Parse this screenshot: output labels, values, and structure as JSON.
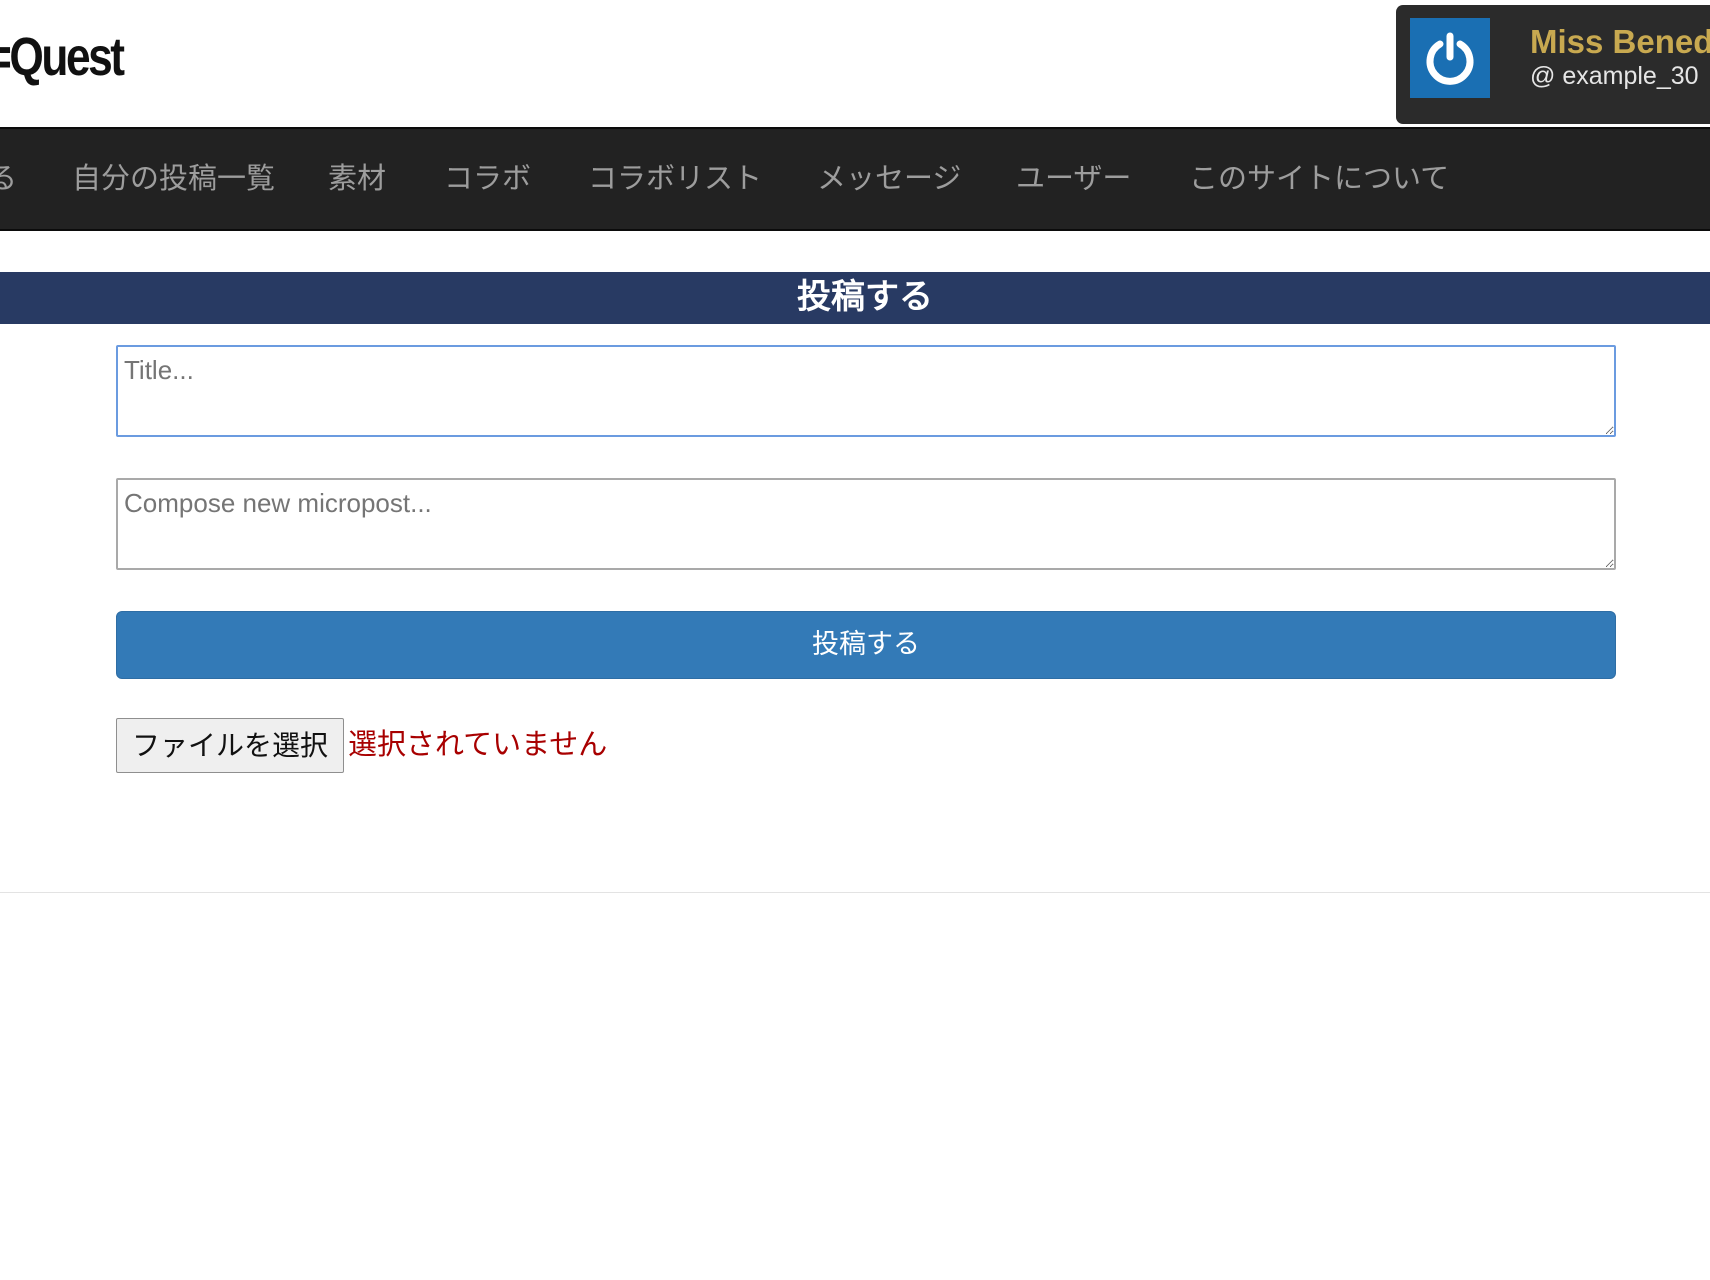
{
  "header": {
    "logo_text": "=Quest"
  },
  "user": {
    "name": "Miss Bened",
    "handle": "@ example_30",
    "avatar_icon": "power-icon",
    "avatar_color": "#1a6fb3",
    "name_color": "#c8a950"
  },
  "nav": {
    "items": [
      {
        "label": "る"
      },
      {
        "label": "自分の投稿一覧"
      },
      {
        "label": "素材"
      },
      {
        "label": "コラボ"
      },
      {
        "label": "コラボリスト"
      },
      {
        "label": "メッセージ"
      },
      {
        "label": "ユーザー"
      },
      {
        "label": "このサイトについて"
      }
    ]
  },
  "post_form": {
    "section_title": "投稿する",
    "title_placeholder": "Title...",
    "content_placeholder": "Compose new micropost...",
    "submit_label": "投稿する",
    "file_button_label": "ファイルを選択",
    "file_status": "選択されていません"
  },
  "colors": {
    "navbar": "#222222",
    "section_header": "#283a63",
    "primary_button": "#337ab7",
    "file_status": "#a80000"
  }
}
